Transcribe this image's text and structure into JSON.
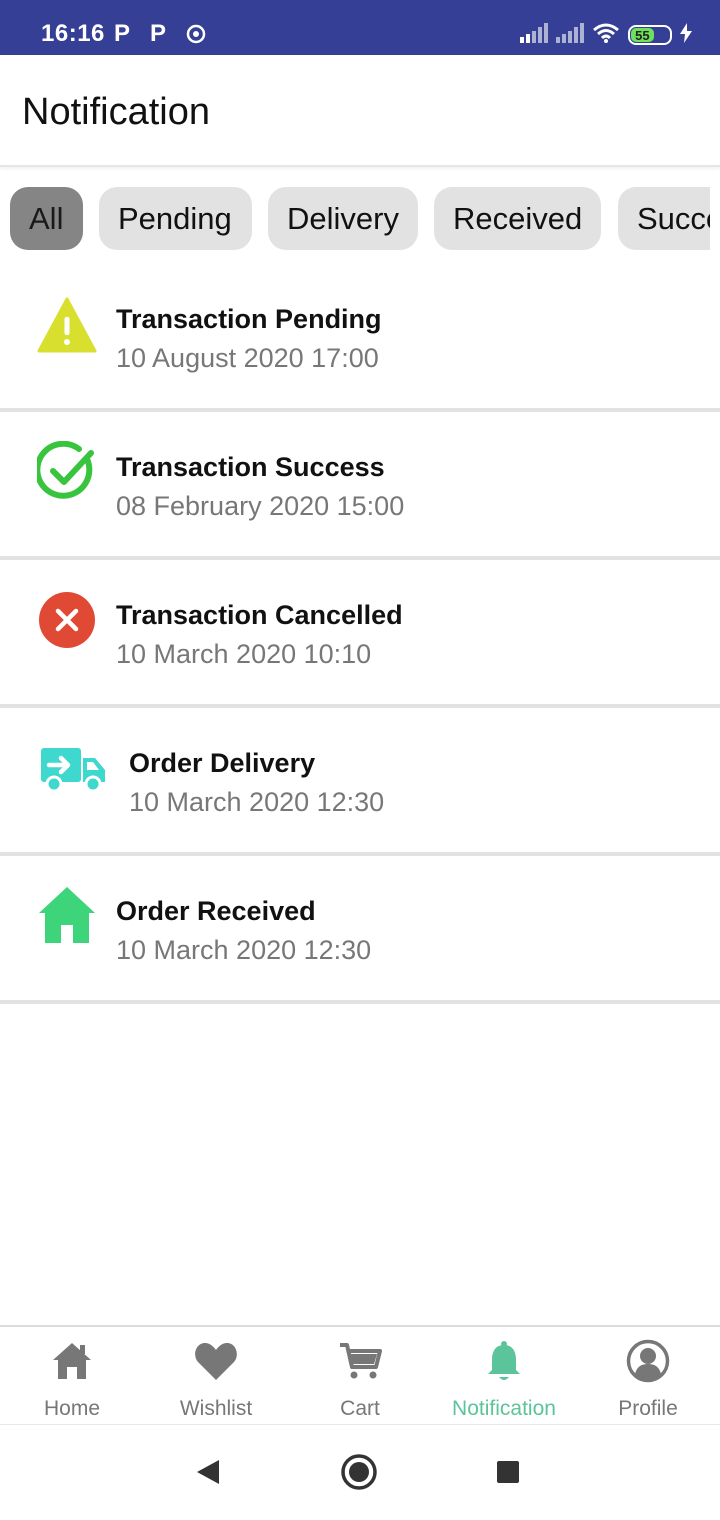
{
  "status_bar": {
    "time": "16:16",
    "notif_p1": "P",
    "notif_p2": "P",
    "battery": "55"
  },
  "header": {
    "title": "Notification"
  },
  "filters": [
    {
      "label": "All",
      "active": true
    },
    {
      "label": "Pending",
      "active": false
    },
    {
      "label": "Delivery",
      "active": false
    },
    {
      "label": "Received",
      "active": false
    },
    {
      "label": "Success",
      "active": false
    }
  ],
  "notifications": [
    {
      "title": "Transaction Pending",
      "date": "10 August 2020 17:00",
      "icon": "warning-icon"
    },
    {
      "title": "Transaction Success",
      "date": "08 February 2020 15:00",
      "icon": "check-circle-icon"
    },
    {
      "title": "Transaction Cancelled",
      "date": "10 March 2020 10:10",
      "icon": "cancel-icon"
    },
    {
      "title": "Order Delivery",
      "date": "10 March 2020 12:30",
      "icon": "delivery-truck-icon"
    },
    {
      "title": "Order Received",
      "date": "10 March 2020 12:30",
      "icon": "house-icon"
    }
  ],
  "bottom_nav": [
    {
      "label": "Home",
      "icon": "home-icon",
      "active": false
    },
    {
      "label": "Wishlist",
      "icon": "heart-icon",
      "active": false
    },
    {
      "label": "Cart",
      "icon": "cart-icon",
      "active": false
    },
    {
      "label": "Notification",
      "icon": "bell-icon",
      "active": true
    },
    {
      "label": "Profile",
      "icon": "profile-icon",
      "active": false
    }
  ],
  "colors": {
    "status_bar": "#343f95",
    "accent": "#5cc49b",
    "warning": "#d9df2e",
    "success": "#39c43e",
    "cancel": "#e04a35",
    "delivery": "#3fd8cf",
    "received": "#3ed57a"
  }
}
